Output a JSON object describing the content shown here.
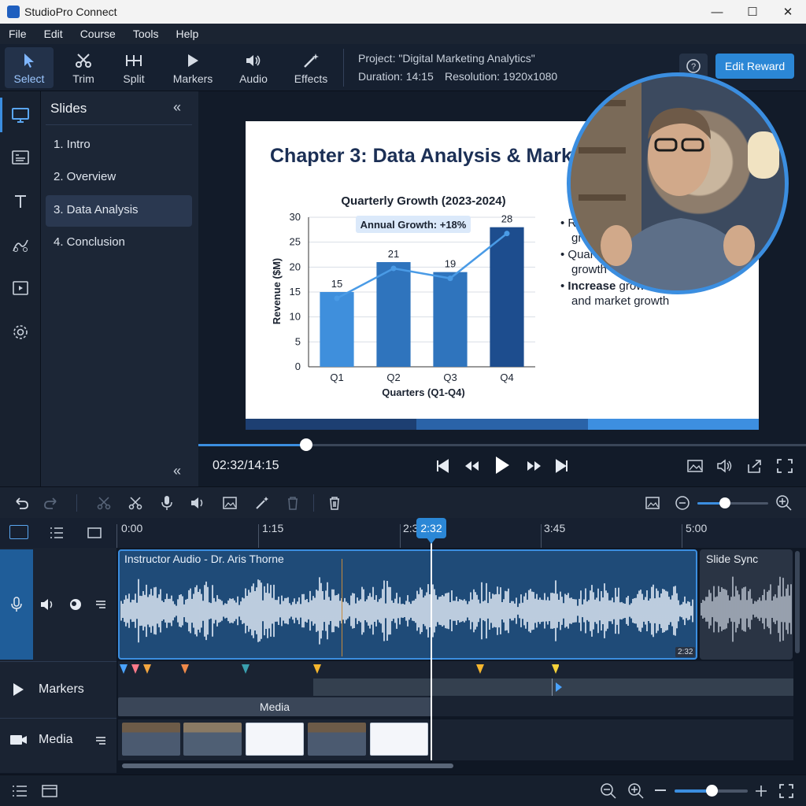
{
  "window": {
    "title": "StudioPro Connect"
  },
  "menu": [
    "File",
    "Edit",
    "Course",
    "Tools",
    "Help"
  ],
  "toolbar": {
    "tools": [
      "Select",
      "Trim",
      "Split",
      "Markers",
      "Audio",
      "Effects"
    ],
    "project_line": "Project: \"Digital Marketing Analytics\"",
    "duration": "Duration: 14:15",
    "resolution": "Resolution: 1920x1080",
    "edit_reward": "Edit Reward"
  },
  "slides_panel": {
    "title": "Slides",
    "items": [
      "1. Intro",
      "2. Overview",
      "3. Data Analysis",
      "4. Conclusion"
    ],
    "selected_index": 2
  },
  "slide": {
    "title": "Chapter 3: Data Analysis & Marke",
    "bullets": [
      {
        "bold": "",
        "text": "Ro"
      },
      {
        "bold": "",
        "text": "grow"
      },
      {
        "bold": "",
        "text": "Quarterly"
      },
      {
        "bold": "",
        "text": "growth changes"
      },
      {
        "bold": "Increase",
        "text": " growth increases"
      },
      {
        "bold": "",
        "text": "and market growth"
      }
    ],
    "footer_colors": [
      "#1d3f72",
      "#2a63a8",
      "#3d8fe0"
    ]
  },
  "chart_data": {
    "type": "bar",
    "title": "Quarterly Growth (2023-2024)",
    "categories": [
      "Q1",
      "Q2",
      "Q3",
      "Q4"
    ],
    "values": [
      15,
      21,
      19,
      28
    ],
    "data_labels": [
      "15",
      "21",
      "19",
      "28"
    ],
    "xlabel": "Quarters (Q1-Q4)",
    "ylabel": "Revenue ($M)",
    "ylim": [
      0,
      30
    ],
    "yticks": [
      "0",
      "5",
      "10",
      "15",
      "20",
      "25",
      "30"
    ],
    "annotation": "Annual Growth: +18%",
    "bar_colors": [
      "#3f8fdc",
      "#2f74bd",
      "#2f74bd",
      "#1d4d8e"
    ],
    "line_color": "#4a9be6",
    "grid": true
  },
  "playback": {
    "current": "02:32",
    "total": "/14:15",
    "progress": 0.178
  },
  "timeline": {
    "ruler_labels": [
      "0:00",
      "1:15",
      "2:3",
      "3:45",
      "5:00"
    ],
    "playhead_label": "2:32",
    "audio_clip_label": "Instructor Audio - Dr. Aris Thorne",
    "audio_clip_time": "2:32",
    "slide_sync_label": "Slide Sync",
    "markers_label": "Markers",
    "media_bar_label": "Media",
    "media_label": "Media",
    "marker_colors": [
      "#4aa3ff",
      "#ff7a8a",
      "#f2a640",
      "#ef8a4a",
      "#3aa0b0",
      "#f5b62e",
      "#f5b62e",
      "#f5d23a"
    ]
  },
  "bottom": {
    "zoom": 0.5
  }
}
